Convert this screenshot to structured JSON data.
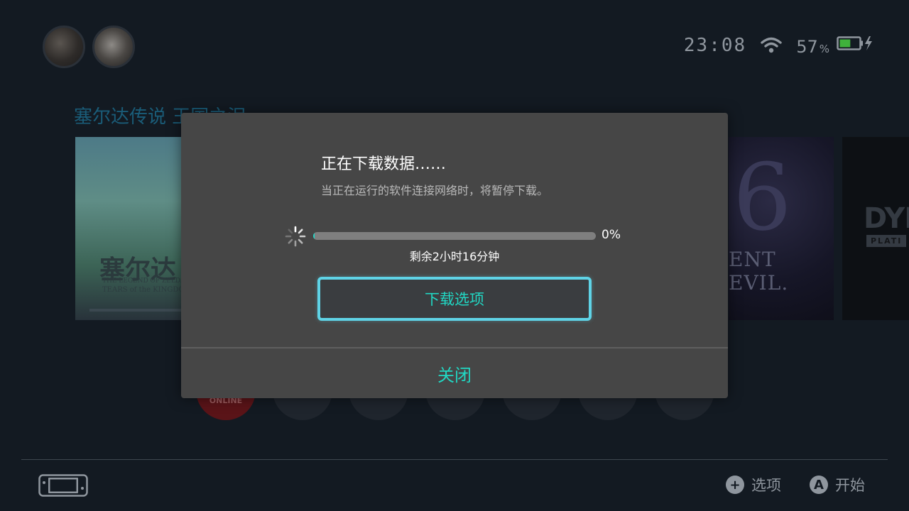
{
  "status": {
    "time": "23:08",
    "battery_percent": "57",
    "battery_unit": "%",
    "battery_level": 0.57,
    "charging": true,
    "icons": [
      "wifi-icon",
      "battery-icon",
      "charging-bolt-icon"
    ]
  },
  "home": {
    "selected_game_title": "塞尔达传说 王国之泪",
    "tiles": {
      "zelda": {
        "logo_text": "塞尔达",
        "sub_line_1": "THE LEGEND OF ZELDA",
        "sub_line_2": "TEARS of the KINGDOM"
      },
      "resident_evil": {
        "mark": "6",
        "text": "ENT EVIL."
      },
      "dying_light": {
        "line1": "DYIN",
        "line2": "PLATI"
      }
    },
    "nso_label": "ONLINE"
  },
  "modal": {
    "title": "正在下载数据……",
    "subtitle": "当正在运行的软件连接网络时，将暂停下载。",
    "progress_value": 0.0,
    "progress_text": "0%",
    "time_remaining": "剩余2小时16分钟",
    "options_button": "下载选项",
    "close_button": "关闭"
  },
  "footer": {
    "hints": [
      {
        "icon": "plus-button-icon",
        "glyph": "+",
        "label": "选项"
      },
      {
        "icon": "a-button-icon",
        "glyph": "A",
        "label": "开始"
      }
    ]
  },
  "colors": {
    "accent": "#21d8c4",
    "focus_border": "#5fd3e6",
    "modal_bg": "#464646",
    "page_bg": "#131a22",
    "battery_fill": "#3fb13b"
  }
}
